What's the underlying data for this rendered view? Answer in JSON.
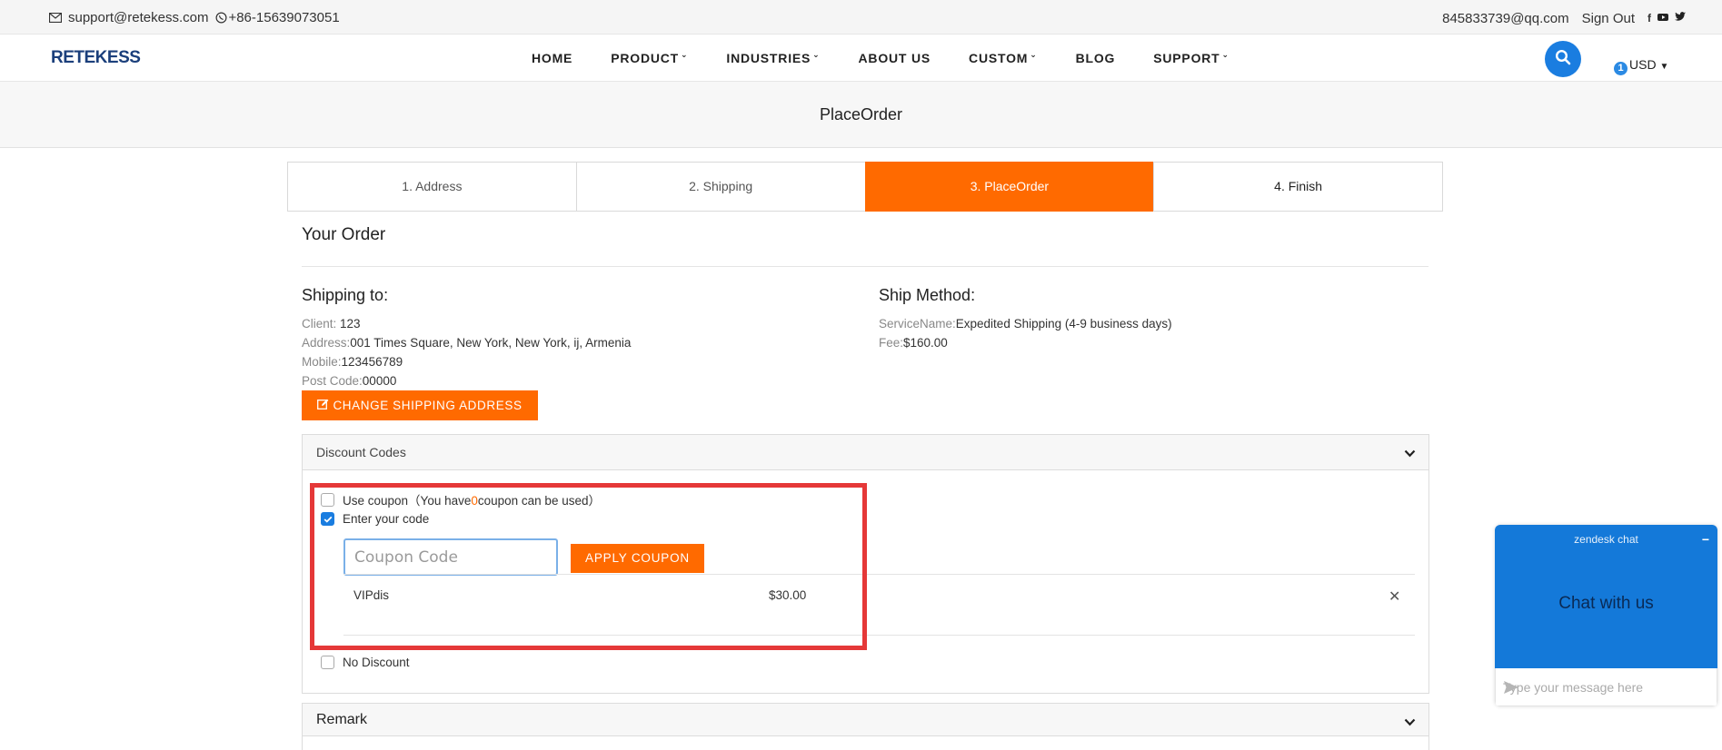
{
  "topbar": {
    "email": "support@retekess.com",
    "phone": "+86-15639073051",
    "account": "845833739@qq.com",
    "sign_out": "Sign Out",
    "social": [
      "f",
      "yt",
      "tw"
    ]
  },
  "nav": {
    "logo": "RETEKESS",
    "items": [
      {
        "label": "HOME",
        "has_dropdown": false
      },
      {
        "label": "PRODUCT",
        "has_dropdown": true
      },
      {
        "label": "INDUSTRIES",
        "has_dropdown": true
      },
      {
        "label": "ABOUT US",
        "has_dropdown": false
      },
      {
        "label": "CUSTOM",
        "has_dropdown": true
      },
      {
        "label": "BLOG",
        "has_dropdown": false
      },
      {
        "label": "SUPPORT",
        "has_dropdown": true
      }
    ],
    "cart_count": "1",
    "currency": "USD"
  },
  "page_title": "PlaceOrder",
  "steps": [
    "1. Address",
    "2. Shipping",
    "3. PlaceOrder",
    "4. Finish"
  ],
  "active_step": 2,
  "order": {
    "heading": "Your Order",
    "shipping_to": {
      "title": "Shipping to:",
      "client_label": "Client: ",
      "client": "123",
      "address_label": "Address:",
      "address": "001 Times Square, New York, New York, ij, Armenia",
      "mobile_label": "Mobile:",
      "mobile": "123456789",
      "postcode_label": "Post Code:",
      "postcode": "00000",
      "change_button": "CHANGE SHIPPING ADDRESS"
    },
    "ship_method": {
      "title": "Ship Method:",
      "service_label": "ServiceName:",
      "service": "Expedited Shipping (4-9 business days)",
      "fee_label": "Fee:",
      "fee": "$160.00"
    }
  },
  "discount": {
    "panel_title": "Discount Codes",
    "use_coupon_pre": "Use coupon（You have",
    "coupon_count": "0",
    "use_coupon_post": "coupon can be used）",
    "use_coupon_checked": false,
    "enter_code_label": "Enter your code",
    "enter_code_checked": true,
    "coupon_placeholder": "Coupon Code",
    "apply_button": "APPLY COUPON",
    "applied_code": "VIPdis",
    "applied_amount": "$30.00",
    "no_discount_label": "No Discount",
    "no_discount_checked": false
  },
  "remark": {
    "title": "Remark"
  },
  "chat": {
    "brand": "zendesk chat",
    "headline": "Chat with us",
    "placeholder": "Type your message here"
  },
  "colors": {
    "accent": "#ff6a00",
    "brand_blue": "#1a7de0",
    "highlight_box": "#e53838",
    "chat_blue": "#1479d9"
  }
}
